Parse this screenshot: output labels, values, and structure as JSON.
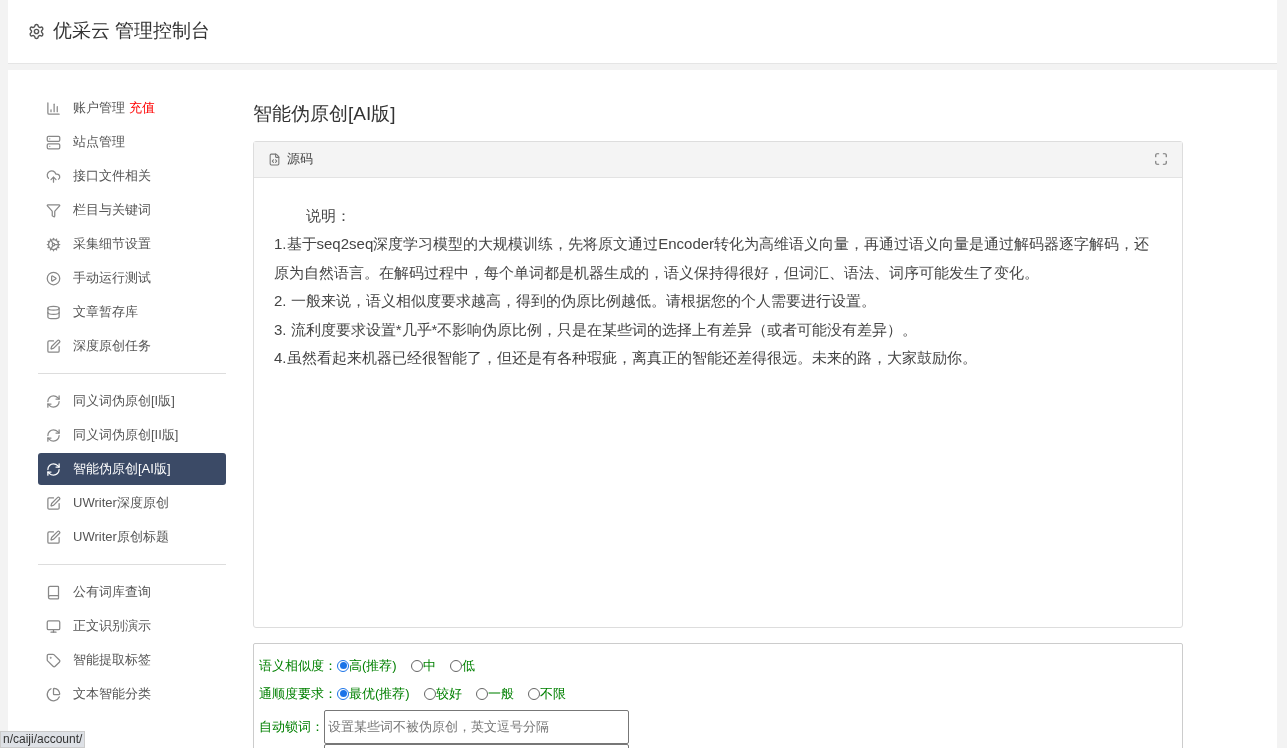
{
  "header": {
    "title": "优采云 管理控制台"
  },
  "sidebar": {
    "groups": [
      {
        "items": [
          {
            "label": "账户管理",
            "badge": "充值",
            "kind": "chart",
            "selected": false
          },
          {
            "label": "站点管理",
            "kind": "server",
            "selected": false
          },
          {
            "label": "接口文件相关",
            "kind": "cloud",
            "selected": false
          },
          {
            "label": "栏目与关键词",
            "kind": "filter",
            "selected": false
          },
          {
            "label": "采集细节设置",
            "kind": "gears",
            "selected": false
          },
          {
            "label": "手动运行测试",
            "kind": "play",
            "selected": false
          },
          {
            "label": "文章暂存库",
            "kind": "database",
            "selected": false
          },
          {
            "label": "深度原创任务",
            "kind": "edit",
            "selected": false
          }
        ]
      },
      {
        "items": [
          {
            "label": "同义词伪原创[I版]",
            "kind": "refresh",
            "selected": false
          },
          {
            "label": "同义词伪原创[II版]",
            "kind": "refresh",
            "selected": false
          },
          {
            "label": "智能伪原创[AI版]",
            "kind": "refresh",
            "selected": true
          },
          {
            "label": "UWriter深度原创",
            "kind": "edit",
            "selected": false
          },
          {
            "label": "UWriter原创标题",
            "kind": "edit",
            "selected": false
          }
        ]
      },
      {
        "items": [
          {
            "label": "公有词库查询",
            "kind": "book",
            "selected": false
          },
          {
            "label": "正文识别演示",
            "kind": "monitor",
            "selected": false
          },
          {
            "label": "智能提取标签",
            "kind": "tag",
            "selected": false
          },
          {
            "label": "文本智能分类",
            "kind": "pie",
            "selected": false
          }
        ]
      }
    ]
  },
  "page_title": "智能伪原创[AI版]",
  "editor": {
    "tab": "源码",
    "heading": "说明：",
    "lines": [
      "1.基于seq2seq深度学习模型的大规模训练，先将原文通过Encoder转化为高维语义向量，再通过语义向量是通过解码器逐字解码，还原为自然语言。在解码过程中，每个单词都是机器生成的，语义保持得很好，但词汇、语法、词序可能发生了变化。",
      "2. 一般来说，语义相似度要求越高，得到的伪原比例越低。请根据您的个人需要进行设置。",
      "3. 流利度要求设置*几乎*不影响伪原比例，只是在某些词的选择上有差异（或者可能没有差异）。",
      "4.虽然看起来机器已经很智能了，但还是有各种瑕疵，离真正的智能还差得很远。未来的路，大家鼓励你。"
    ]
  },
  "options": [
    {
      "kind": "radio",
      "label": "语义相似度：",
      "choices": [
        {
          "label": "高(推荐)",
          "selected": true
        },
        {
          "label": "中",
          "selected": false
        },
        {
          "label": "低",
          "selected": false
        }
      ]
    },
    {
      "kind": "radio",
      "label": "通顺度要求：",
      "choices": [
        {
          "label": "最优(推荐)",
          "selected": true
        },
        {
          "label": "较好",
          "selected": false
        },
        {
          "label": "一般",
          "selected": false
        },
        {
          "label": "不限",
          "selected": false
        }
      ]
    },
    {
      "kind": "input",
      "label": "自动锁词：",
      "placeholder": "设置某些词不被伪原创，英文逗号分隔"
    }
  ],
  "status_url": "n/caiji/account/"
}
